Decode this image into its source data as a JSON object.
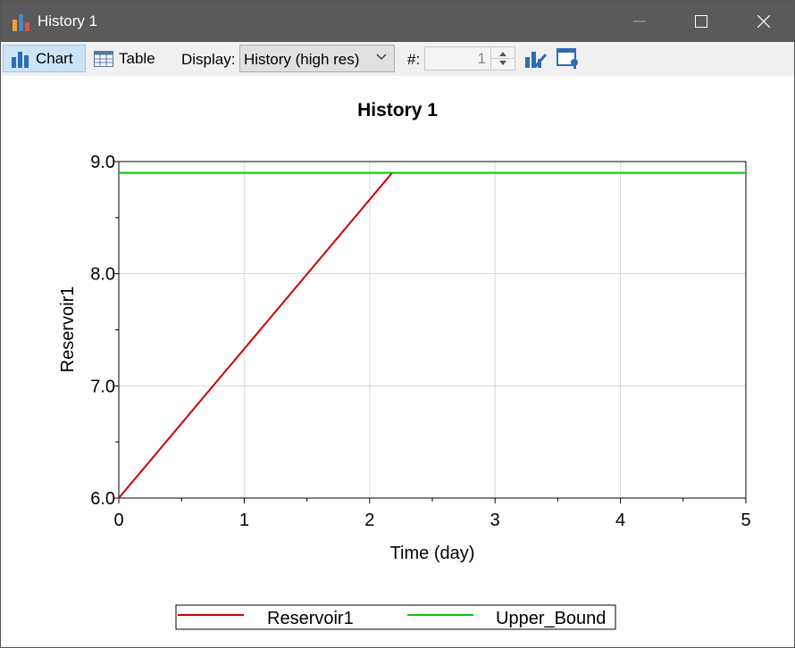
{
  "window": {
    "title": "History 1",
    "icons": {
      "app": "bar-chart-icon",
      "minimize": "minimize-icon",
      "maximize": "maximize-icon",
      "close": "close-icon"
    }
  },
  "toolbar": {
    "chart_label": "Chart",
    "table_label": "Table",
    "display_label": "Display:",
    "display_value": "History (high res)",
    "number_label": "#:",
    "number_value": "1"
  },
  "chart_data": {
    "type": "line",
    "title": "History 1",
    "xlabel": "Time (day)",
    "ylabel": "Reservoir1",
    "xlim": [
      0,
      5
    ],
    "ylim": [
      6.0,
      9.0
    ],
    "xticks": [
      "0",
      "1",
      "2",
      "3",
      "4",
      "5"
    ],
    "yticks": [
      "6.0",
      "7.0",
      "8.0",
      "9.0"
    ],
    "grid": true,
    "legend": "bottom",
    "series": [
      {
        "name": "Reservoir1",
        "color": "#cc0000",
        "x": [
          0,
          2.18
        ],
        "y": [
          6.0,
          8.9
        ]
      },
      {
        "name": "Upper_Bound",
        "color": "#00cc00",
        "x": [
          0,
          5
        ],
        "y": [
          8.9,
          8.9
        ]
      }
    ]
  }
}
